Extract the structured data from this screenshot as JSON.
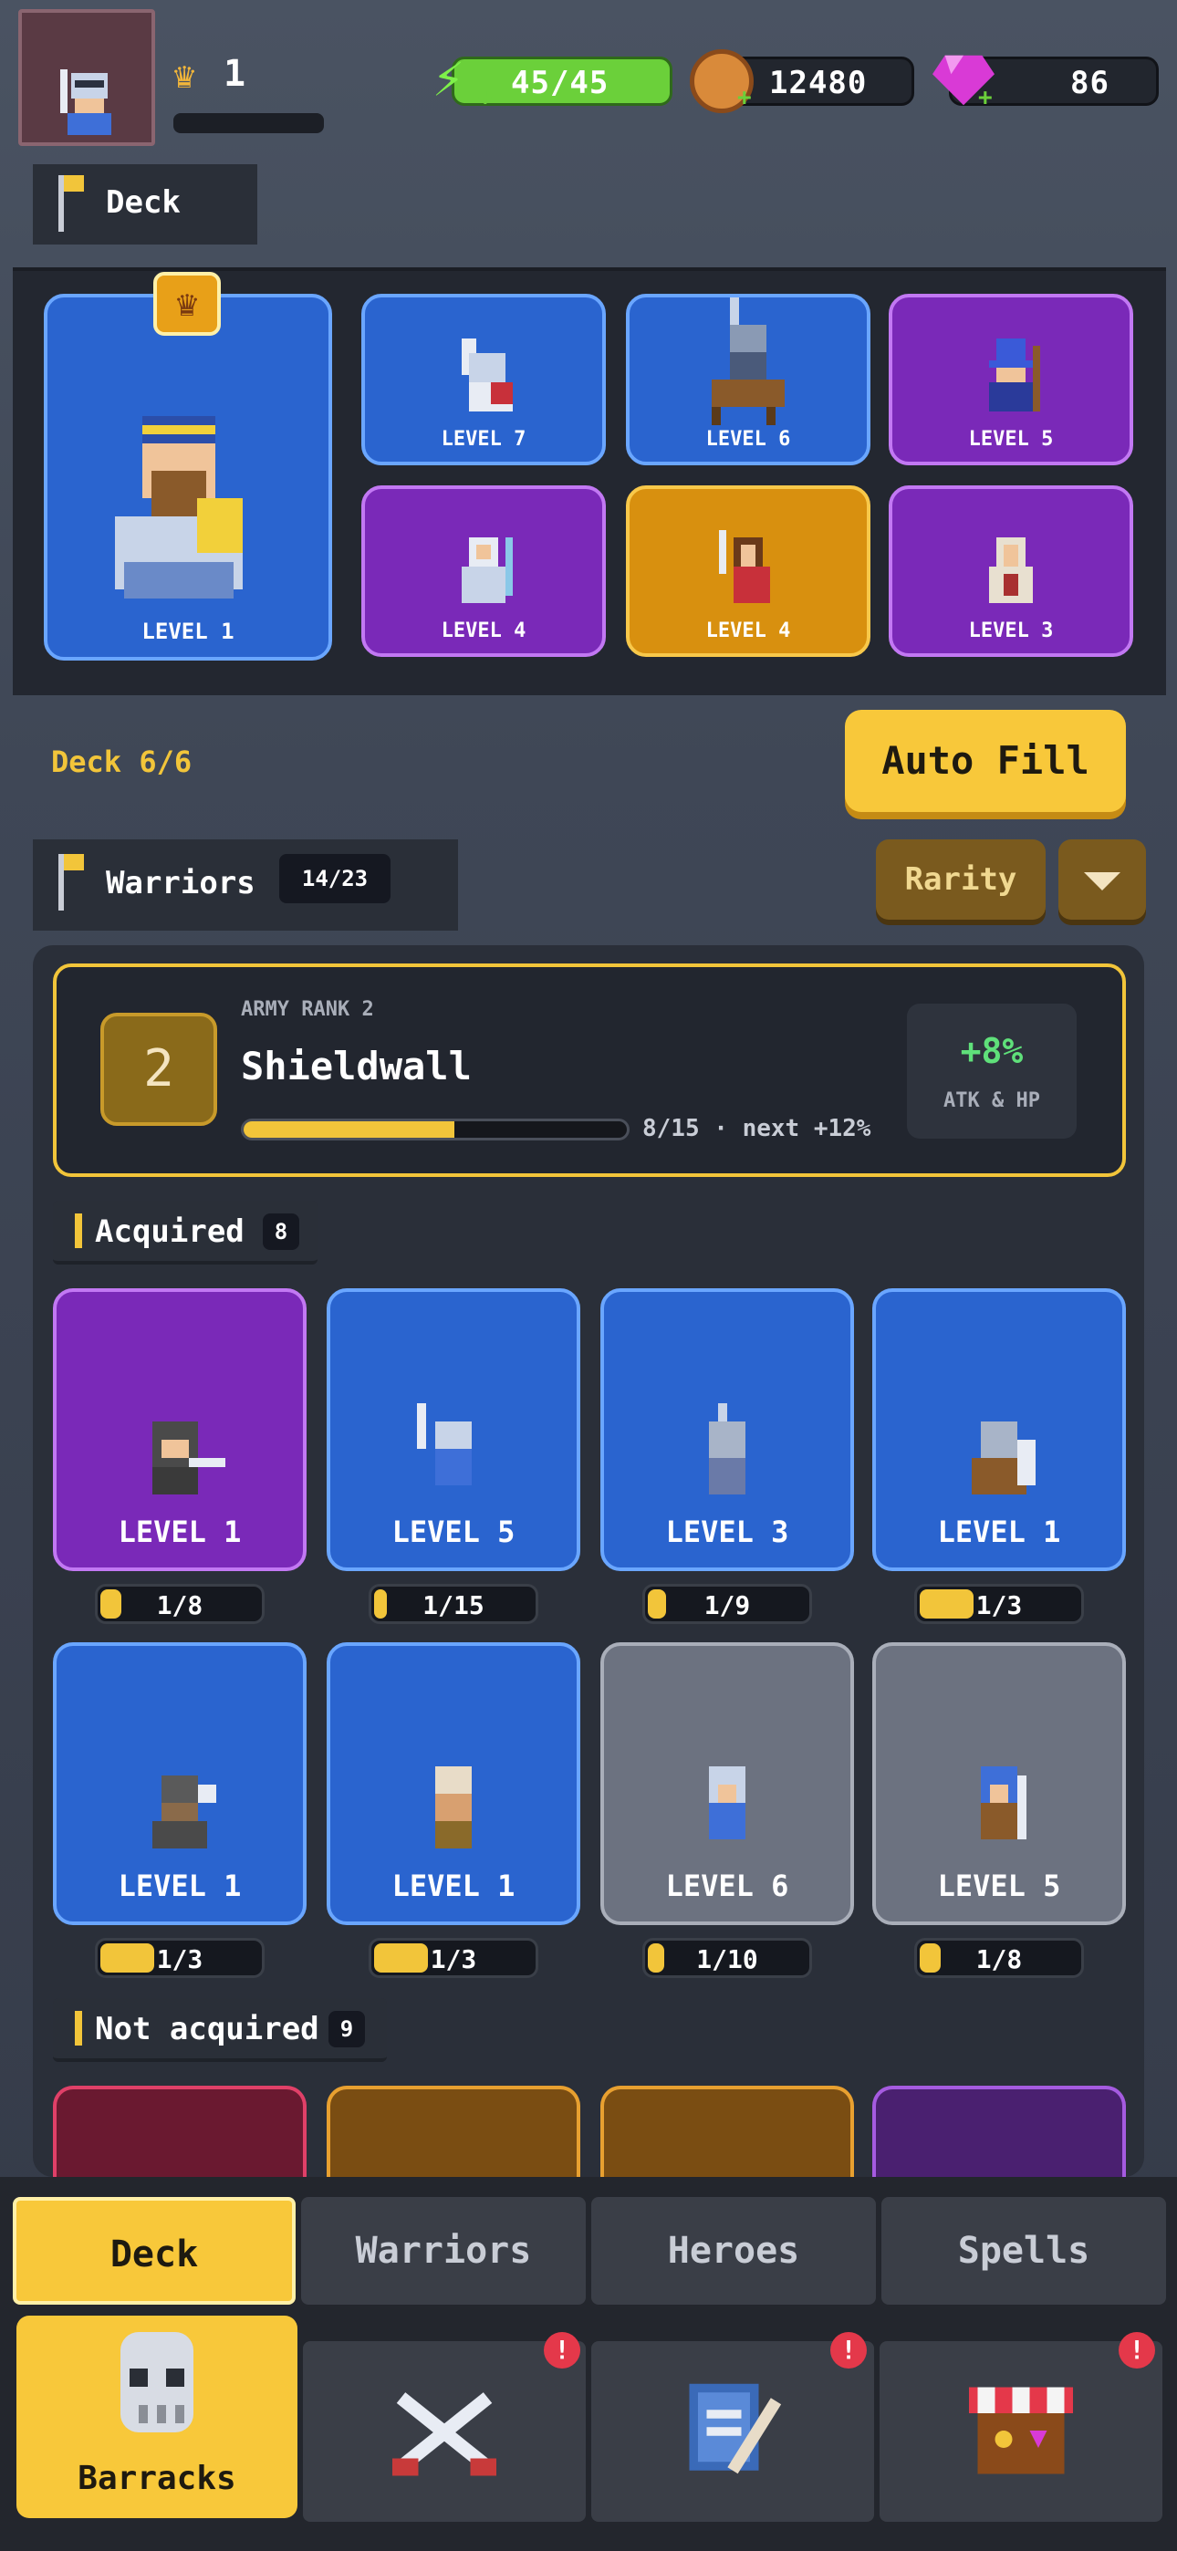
{
  "top_bar": {
    "player_rank": "1",
    "energy": "45/45",
    "coins": "12480",
    "gems": "86",
    "icons": {
      "avatar": "knight-avatar-icon",
      "crown": "crown-icon",
      "energy": "lightning-icon",
      "coins": "coin-icon",
      "gems": "gem-icon",
      "add": "plus-icon"
    }
  },
  "deck_banner": {
    "label": "Deck"
  },
  "deck": {
    "hero": {
      "level": "LEVEL 1",
      "rarity": "blue",
      "icon": "crown-icon"
    },
    "cards": [
      {
        "level": "LEVEL 7",
        "rarity": "blue"
      },
      {
        "level": "LEVEL 6",
        "rarity": "blue"
      },
      {
        "level": "LEVEL 5",
        "rarity": "purple"
      },
      {
        "level": "LEVEL 4",
        "rarity": "purple"
      },
      {
        "level": "LEVEL 4",
        "rarity": "gold"
      },
      {
        "level": "LEVEL 3",
        "rarity": "purple"
      }
    ],
    "count_label": "Deck 6/6",
    "auto_fill_label": "Auto Fill"
  },
  "warriors_banner": {
    "label": "Warriors",
    "count": "14/23"
  },
  "sort": {
    "label": "Rarity",
    "dropdown_icon": "chevron-down-icon"
  },
  "army_rank": {
    "caption": "ARMY RANK 2",
    "number": "2",
    "name": "Shieldwall",
    "progress_fraction": 0.55,
    "progress_text": "8/15 · next +12%",
    "bonus": "+8%",
    "bonus_label": "ATK & HP"
  },
  "acquired": {
    "label": "Acquired",
    "count": "8",
    "items": [
      {
        "level": "LEVEL 1",
        "rarity": "purple",
        "count": "1/8",
        "fill": 0.125
      },
      {
        "level": "LEVEL 5",
        "rarity": "blue",
        "count": "1/15",
        "fill": 0.067
      },
      {
        "level": "LEVEL 3",
        "rarity": "blue",
        "count": "1/9",
        "fill": 0.11
      },
      {
        "level": "LEVEL 1",
        "rarity": "blue",
        "count": "1/3",
        "fill": 0.33
      },
      {
        "level": "LEVEL 1",
        "rarity": "blue",
        "count": "1/3",
        "fill": 0.33
      },
      {
        "level": "LEVEL 1",
        "rarity": "blue",
        "count": "1/3",
        "fill": 0.33
      },
      {
        "level": "LEVEL 6",
        "rarity": "gray",
        "count": "1/10",
        "fill": 0.1
      },
      {
        "level": "LEVEL 5",
        "rarity": "gray",
        "count": "1/8",
        "fill": 0.125
      }
    ]
  },
  "not_acquired": {
    "label": "Not acquired",
    "count": "9",
    "rarities": [
      "red",
      "darkgold",
      "darkgold",
      "darkpurple"
    ]
  },
  "tabs": [
    {
      "label": "Deck",
      "active": true
    },
    {
      "label": "Warriors",
      "active": false
    },
    {
      "label": "Heroes",
      "active": false
    },
    {
      "label": "Spells",
      "active": false
    }
  ],
  "nav": {
    "barracks_label": "Barracks",
    "badge": "!",
    "icons": [
      "helmet-icon",
      "crossed-swords-icon",
      "spellbook-icon",
      "shop-icon"
    ]
  },
  "colors": {
    "accent": "#f8c83a",
    "blue_card": "#2a64cf",
    "purple_card": "#7a29b8",
    "gold_card": "#d8900f",
    "gray_card": "#6c7280",
    "energy": "#6bd03a",
    "gem": "#d93ad6",
    "alert": "#e4384a"
  }
}
